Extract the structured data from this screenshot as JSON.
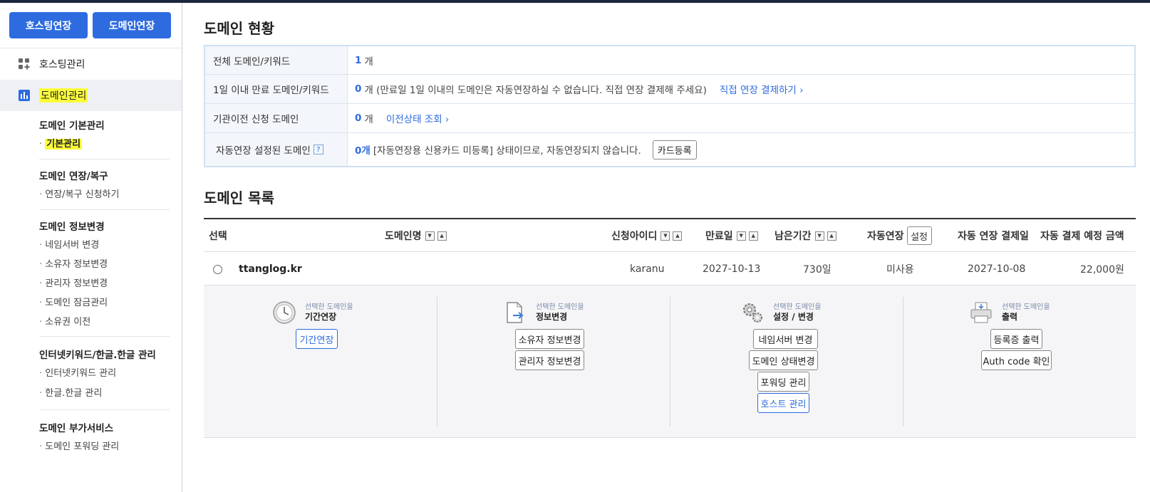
{
  "sidebar": {
    "hosting_extend": "호스팅연장",
    "domain_extend": "도메인연장",
    "hosting_manage": "호스팅관리",
    "domain_manage": "도메인관리",
    "groups": [
      {
        "title": "도메인 기본관리",
        "items": [
          "기본관리"
        ]
      },
      {
        "title": "도메인 연장/복구",
        "items": [
          "연장/복구 신청하기"
        ]
      },
      {
        "title": "도메인 정보변경",
        "items": [
          "네임서버 변경",
          "소유자 정보변경",
          "관리자 정보변경",
          "도메인 잠금관리",
          "소유권 이전"
        ]
      },
      {
        "title": "인터넷키워드/한글.한글 관리",
        "items": [
          "인터넷키워드 관리",
          "한글.한글 관리"
        ]
      },
      {
        "title": "도메인 부가서비스",
        "items": [
          "도메인 포워딩 관리"
        ]
      }
    ]
  },
  "status": {
    "title": "도메인 현황",
    "rows": [
      {
        "key": "전체 도메인/키워드",
        "num": "1",
        "text": "개"
      },
      {
        "key": "1일 이내 만료 도메인/키워드",
        "num": "0",
        "text": "개 (만료일 1일 이내의 도메인은 자동연장하실 수 없습니다. 직접 연장 결제해 주세요)",
        "link": "직접 연장 결제하기 ›"
      },
      {
        "key": "기관이전 신청 도메인",
        "num": "0",
        "text": "개",
        "link": "이전상태 조회 ›"
      },
      {
        "key": "자동연장 설정된 도메인",
        "qmark": "?",
        "num": "0개",
        "text": "[자동연장용 신용카드 미등록] 상태이므로, 자동연장되지 않습니다.",
        "button": "카드등록"
      }
    ]
  },
  "list": {
    "title": "도메인 목록",
    "headers": {
      "select": "선택",
      "domain": "도메인명",
      "user_id": "신청아이디",
      "expire": "만료일",
      "remaining": "남은기간",
      "auto": "자동연장",
      "auto_btn": "설정",
      "auto_date": "자동 연장 결제일",
      "auto_amount": "자동 결제 예정 금액"
    },
    "rows": [
      {
        "domain": "ttanglog.kr",
        "user_id": "karanu",
        "expire": "2027-10-13",
        "remaining": "730일",
        "auto": "미사용",
        "auto_date": "2027-10-08",
        "auto_amount": "22,000원"
      }
    ]
  },
  "actions": [
    {
      "small": "선택한 도메인을",
      "big": "기간연장",
      "icon": "clock-icon",
      "buttons": [
        "기간연장"
      ]
    },
    {
      "small": "선택한 도메인을",
      "big": "정보변경",
      "icon": "document-arrow-icon",
      "buttons": [
        "소유자 정보변경",
        "관리자 정보변경"
      ]
    },
    {
      "small": "선택한 도메인을",
      "big": "설정 / 변경",
      "icon": "gears-icon",
      "buttons": [
        "네임서버 변경",
        "도메인 상태변경",
        "포워딩 관리",
        "호스트 관리"
      ]
    },
    {
      "small": "선택한 도메인을",
      "big": "출력",
      "icon": "printer-icon",
      "buttons": [
        "등록증 출력",
        "Auth code 확인"
      ]
    }
  ],
  "colors": {
    "accent": "#2d6bdf",
    "highlight": "#fcfd3a",
    "topbar": "#1b2640"
  }
}
